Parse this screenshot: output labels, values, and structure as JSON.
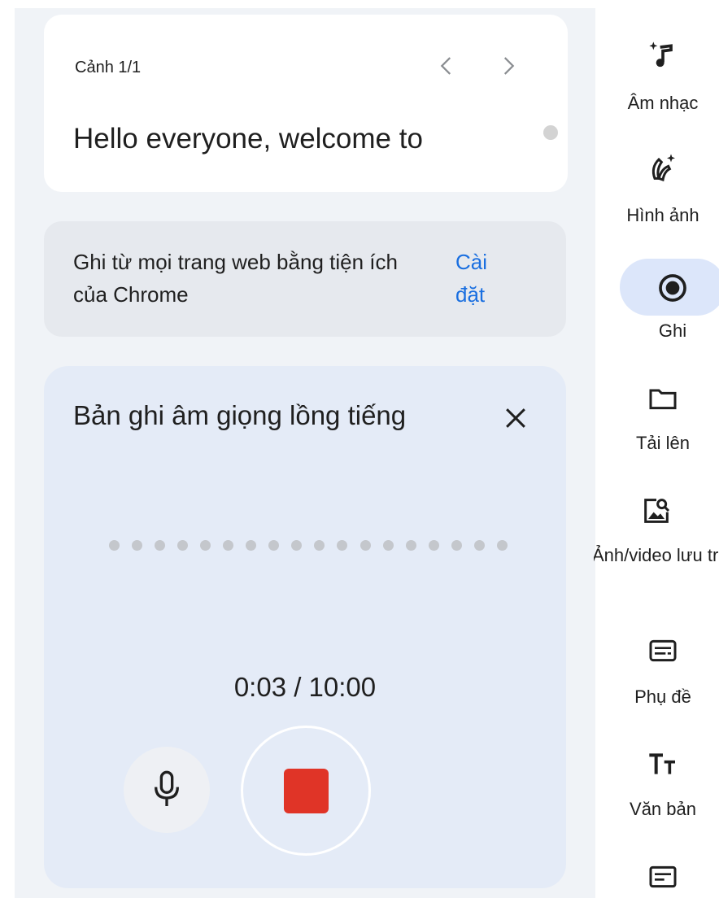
{
  "scene": {
    "label": "Cảnh 1/1",
    "text": "Hello everyone, welcome to"
  },
  "extension_notice": {
    "text": "Ghi từ mọi trang web bằng tiện ích của Chrome",
    "link": "Cài đặt"
  },
  "recording": {
    "title": "Bản ghi âm giọng lồng tiếng",
    "elapsed": "0:03",
    "total": "10:00",
    "timer": "0:03 / 10:00",
    "stop_color": "#e03427"
  },
  "rail": {
    "items": [
      {
        "label": "Âm nhạc",
        "icon": "music-sparkle-icon"
      },
      {
        "label": "Hình ảnh",
        "icon": "banana-sparkle-icon"
      },
      {
        "label": "Ghi",
        "icon": "record-icon",
        "active": true
      },
      {
        "label": "Tải lên",
        "icon": "folder-icon"
      },
      {
        "label": "Ảnh/video lưu trữ",
        "icon": "image-search-icon"
      },
      {
        "label": "Phụ đề",
        "icon": "subtitles-icon"
      },
      {
        "label": "Văn bản",
        "icon": "text-size-icon"
      },
      {
        "label": "",
        "icon": "article-icon"
      }
    ]
  },
  "colors": {
    "accent": "#1a6fe0",
    "active_pill": "#dce6fa"
  }
}
